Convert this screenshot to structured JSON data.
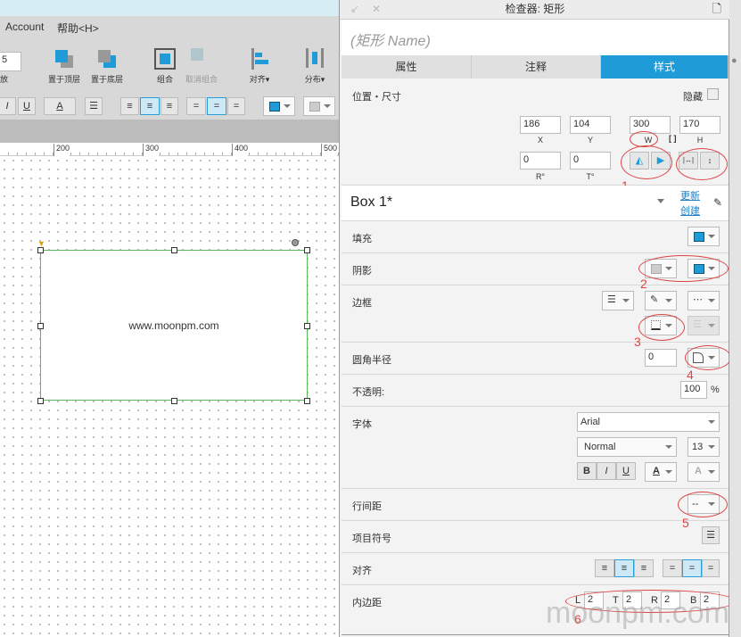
{
  "menu": {
    "account": "Account",
    "help": "帮助<H>"
  },
  "toolbar": {
    "zoom_value": "5",
    "zoom_label": "放",
    "bring_front": "置于顶层",
    "send_back": "置于底层",
    "group": "组合",
    "ungroup": "取消组合",
    "align": "对齐▾",
    "distribute": "分布▾"
  },
  "format": {
    "italic": "I",
    "underline": "U",
    "font_color": "A"
  },
  "ruler": [
    "200",
    "300",
    "400",
    "500"
  ],
  "canvas": {
    "shape_text": "www.moonpm.com"
  },
  "inspector": {
    "title": "检查器: 矩形",
    "name_placeholder": "(矩形 Name)",
    "tabs": [
      {
        "label": "属性"
      },
      {
        "label": "注释"
      },
      {
        "label": "样式",
        "active": true
      }
    ],
    "position": {
      "label": "位置・尺寸",
      "hidden_label": "隐藏",
      "hidden": false,
      "x": "186",
      "y": "104",
      "w": "300",
      "h": "170",
      "x_cap": "X",
      "y_cap": "Y",
      "w_cap": "W",
      "h_cap": "H",
      "r": "0",
      "t": "0",
      "r_cap": "R°",
      "t_cap": "T°"
    },
    "style": {
      "name": "Box 1*",
      "update": "更新",
      "create": "创建"
    },
    "fill": {
      "label": "填充",
      "color": "#1f9bd7"
    },
    "shadow": {
      "label": "阴影"
    },
    "border": {
      "label": "边框"
    },
    "corner": {
      "label": "圆角半径",
      "value": "0"
    },
    "opacity": {
      "label": "不透明:",
      "value": "100",
      "unit": "%"
    },
    "font": {
      "label": "字体",
      "family": "Arial",
      "weight": "Normal",
      "size": "13",
      "bold": "B",
      "italic": "I",
      "underline": "U",
      "color": "A",
      "effect": "A"
    },
    "line_spacing": {
      "label": "行间距",
      "value": "--"
    },
    "bullets": {
      "label": "项目符号"
    },
    "align": {
      "label": "对齐"
    },
    "padding": {
      "label": "内边距",
      "l_cap": "L",
      "t_cap": "T",
      "r_cap": "R",
      "b_cap": "B",
      "l": "2",
      "t": "2",
      "r": "2",
      "b": "2"
    }
  },
  "annotations": [
    "1",
    "2",
    "3",
    "4",
    "5",
    "6"
  ],
  "watermark": "moonpm.com",
  "accent": "#1f9bd7"
}
